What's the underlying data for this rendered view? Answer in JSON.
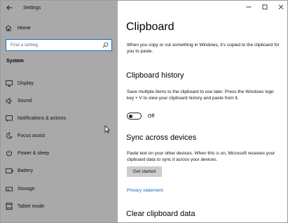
{
  "window": {
    "title": "Settings"
  },
  "nav": {
    "home_label": "Home",
    "search_placeholder": "Find a setting",
    "section_header": "System",
    "items": [
      {
        "label": "Display",
        "icon": "display-icon"
      },
      {
        "label": "Sound",
        "icon": "sound-icon"
      },
      {
        "label": "Notifications & actions",
        "icon": "notifications-icon"
      },
      {
        "label": "Focus assist",
        "icon": "moon-icon"
      },
      {
        "label": "Power & sleep",
        "icon": "power-icon"
      },
      {
        "label": "Battery",
        "icon": "battery-icon"
      },
      {
        "label": "Storage",
        "icon": "storage-icon"
      },
      {
        "label": "Tablet mode",
        "icon": "tablet-icon"
      }
    ]
  },
  "content": {
    "title": "Clipboard",
    "intro": "When you copy or cut something in Windows, it's copied to the clipboard for you to paste.",
    "history": {
      "heading": "Clipboard history",
      "description": "Save multiple items to the clipboard to use later. Press the Windows logo key + V to view your clipboard history and paste from it.",
      "toggle_state": "Off"
    },
    "sync": {
      "heading": "Sync across devices",
      "description": "Paste text on your other devices. When this is on, Microsoft receives your clipboard data to sync it across your devices.",
      "button_label": "Get started"
    },
    "privacy_link": "Privacy statement",
    "clear": {
      "heading": "Clear clipboard data"
    }
  },
  "colors": {
    "nav_background": "#a9a9a9",
    "accent": "#0a6cd6",
    "link": "#1163c4"
  }
}
